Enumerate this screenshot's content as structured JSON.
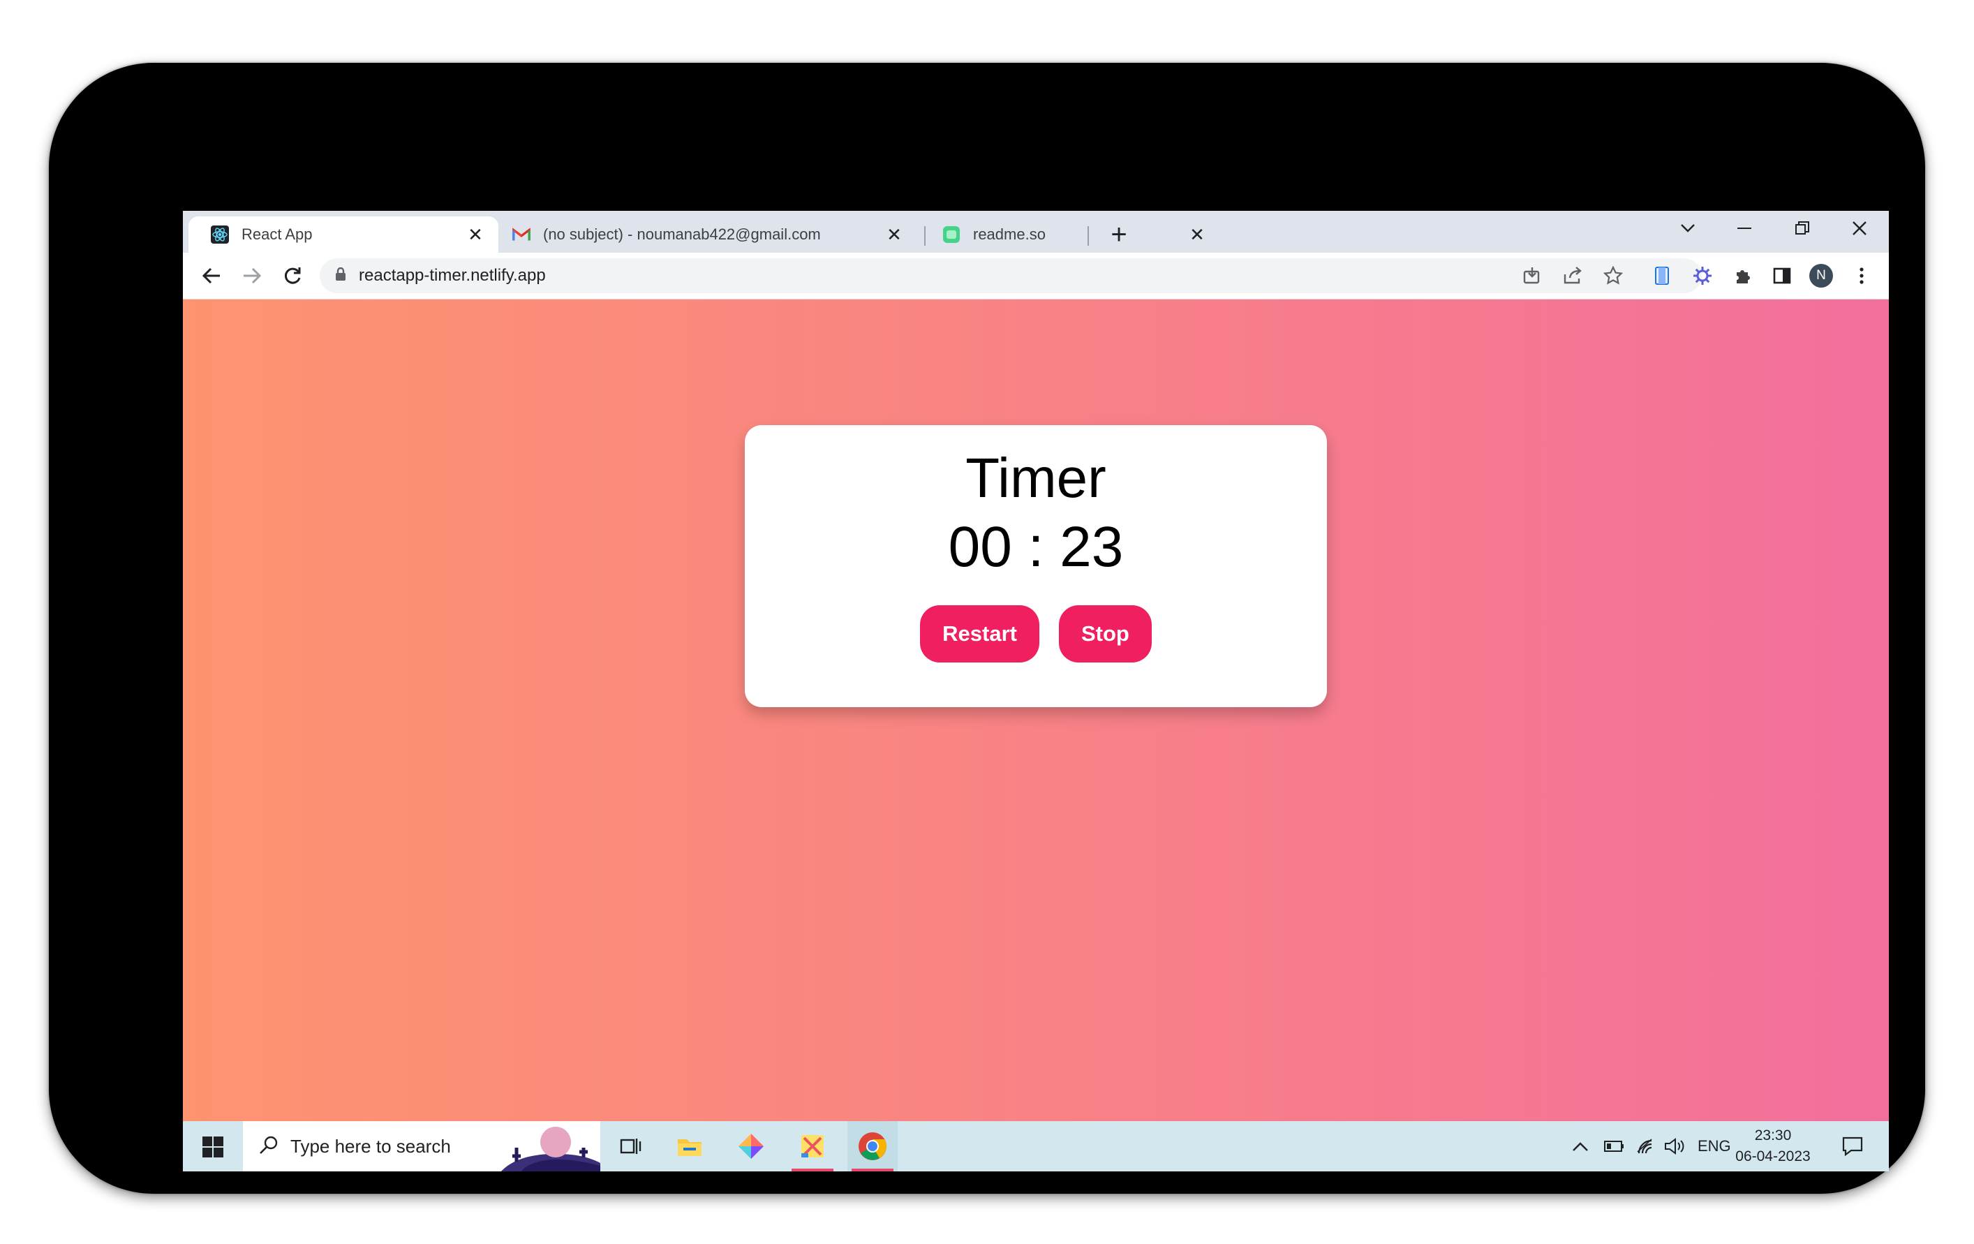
{
  "browser": {
    "tabs": [
      {
        "title": "React App",
        "icon": "react-icon",
        "active": true
      },
      {
        "title": "(no subject) - noumanab422@gmail.com",
        "icon": "gmail-icon",
        "active": false
      },
      {
        "title": "readme.so",
        "icon": "readme-icon",
        "active": false
      }
    ],
    "new_tab_label": "+",
    "url": "reactapp-timer.netlify.app",
    "profile_initial": "N"
  },
  "page": {
    "title": "Timer",
    "time": "00 : 23",
    "buttons": {
      "restart": "Restart",
      "stop": "Stop"
    },
    "colors": {
      "gradient_start": "#fe9370",
      "gradient_end": "#f26f9c",
      "button": "#f01f5f"
    }
  },
  "taskbar": {
    "search_placeholder": "Type here to search",
    "language": "ENG",
    "time": "23:30",
    "date": "06-04-2023"
  }
}
